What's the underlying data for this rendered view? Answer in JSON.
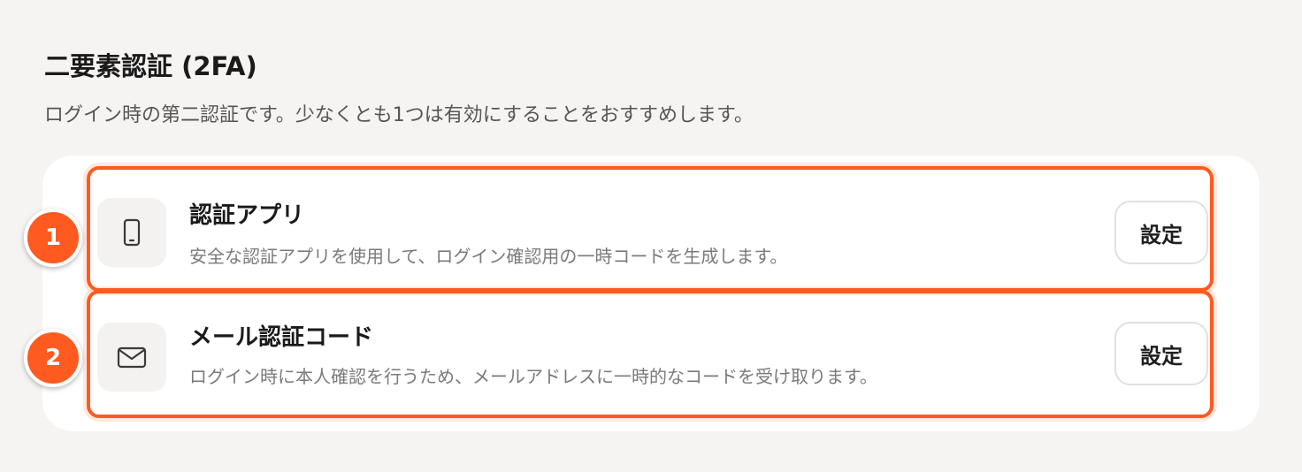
{
  "section": {
    "title": "二要素認証 (2FA)",
    "description": "ログイン時の第二認証です。少なくとも1つは有効にすることをおすすめします。"
  },
  "options": [
    {
      "icon": "smartphone-icon",
      "title": "認証アプリ",
      "description": "安全な認証アプリを使用して、ログイン確認用の一時コードを生成します。",
      "button_label": "設定",
      "badge": "1"
    },
    {
      "icon": "mail-icon",
      "title": "メール認証コード",
      "description": "ログイン時に本人確認を行うため、メールアドレスに一時的なコードを受け取ります。",
      "button_label": "設定",
      "badge": "2"
    }
  ],
  "colors": {
    "accent": "#ff5a1f",
    "background": "#f5f4f2",
    "card": "#ffffff"
  }
}
